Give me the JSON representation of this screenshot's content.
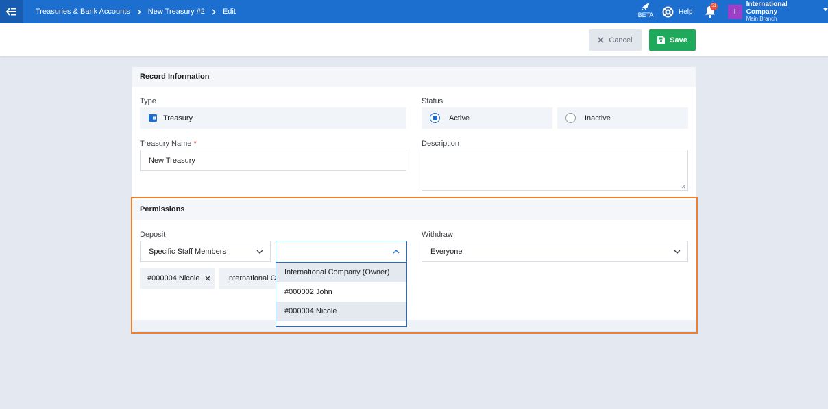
{
  "breadcrumb": [
    "Treasuries & Bank Accounts",
    "New Treasury #2",
    "Edit"
  ],
  "header": {
    "beta_label": "BETA",
    "help_label": "Help",
    "notification_count": "51",
    "company_initial": "I",
    "company_name": "International Company",
    "branch_name": "Main Branch"
  },
  "actions": {
    "cancel_label": "Cancel",
    "save_label": "Save"
  },
  "record": {
    "section_title": "Record Information",
    "type_label": "Type",
    "type_value": "Treasury",
    "status_label": "Status",
    "status_options": [
      "Active",
      "Inactive"
    ],
    "status_selected": "Active",
    "name_label": "Treasury Name",
    "name_required_mark": "*",
    "name_value": "New Treasury",
    "description_label": "Description",
    "description_value": ""
  },
  "permissions": {
    "section_title": "Permissions",
    "deposit_label": "Deposit",
    "deposit_mode": "Specific Staff Members",
    "deposit_search": "",
    "deposit_tags": [
      "#000004 Nicole",
      "International Company (Owner)"
    ],
    "withdraw_label": "Withdraw",
    "withdraw_mode": "Everyone",
    "dropdown_options": [
      "International Company (Owner)",
      "#000002 John",
      "#000004 Nicole"
    ]
  },
  "colors": {
    "primary": "#1d6fcf",
    "save": "#1faa5b",
    "highlight": "#f07e2b",
    "required": "#e0343f"
  }
}
